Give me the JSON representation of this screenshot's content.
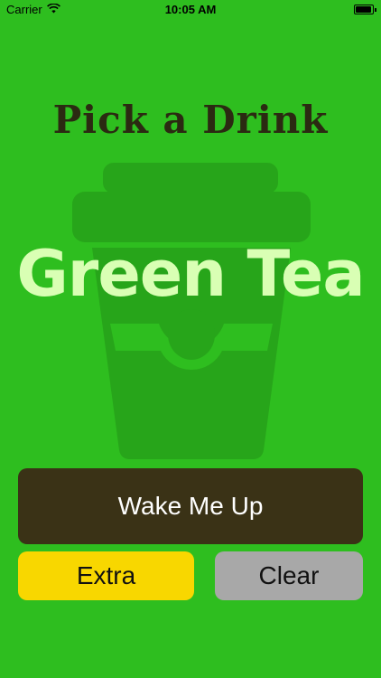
{
  "status_bar": {
    "carrier": "Carrier",
    "time": "10:05 AM",
    "wifi_icon": "wifi-icon",
    "battery_icon": "battery-icon"
  },
  "screen": {
    "title": "Pick a Drink",
    "drink_name": "Green Tea",
    "background_icon": "coffee-cup-icon"
  },
  "buttons": {
    "wake": "Wake Me Up",
    "extra": "Extra",
    "clear": "Clear"
  },
  "colors": {
    "background": "#2ebe1f",
    "title": "#2b2a12",
    "drink_name": "#d9ffb4",
    "wake_button": "#3a3216",
    "extra_button": "#f8d700",
    "clear_button": "#a8a8a8"
  }
}
